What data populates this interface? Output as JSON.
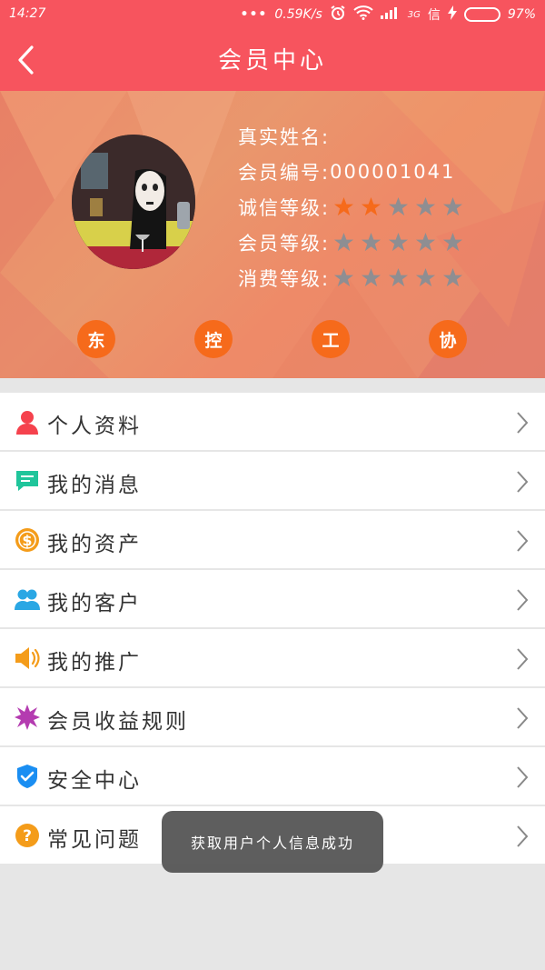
{
  "status_bar": {
    "time": "14:27",
    "dots": "•••",
    "speed": "0.59K/s",
    "network": "3G",
    "battery_pct": "97%",
    "battery_level": 0.97,
    "battery_color": "#56d653"
  },
  "header": {
    "title": "会员中心",
    "back_icon": "chevron-left-icon",
    "bg_color": "#f7545e"
  },
  "profile": {
    "name_label": "真实姓名:",
    "name_value": "",
    "member_no_label": "会员编号:",
    "member_no_value": "000001041",
    "credit_label": "诚信等级:",
    "credit_stars": 2,
    "member_level_label": "会员等级:",
    "member_level_stars": 0,
    "consume_label": "消费等级:",
    "consume_stars": 0,
    "max_stars": 5,
    "star_on_color": "#f66a1b",
    "star_off_color": "#8e8e92",
    "chips": [
      "东",
      "控",
      "工",
      "协"
    ],
    "chip_color": "#f66a1b"
  },
  "menu": [
    {
      "label": "个人资料",
      "icon": "person-icon",
      "color": "#f5424d"
    },
    {
      "label": "我的消息",
      "icon": "message-icon",
      "color": "#1fc59b"
    },
    {
      "label": "我的资产",
      "icon": "dollar-coin-icon",
      "color": "#f49c1a"
    },
    {
      "label": "我的客户",
      "icon": "users-icon",
      "color": "#2aa7e4"
    },
    {
      "label": "我的推广",
      "icon": "megaphone-icon",
      "color": "#f49c1a"
    },
    {
      "label": "会员收益规则",
      "icon": "starburst-icon",
      "color": "#b43bb0"
    },
    {
      "label": "安全中心",
      "icon": "shield-check-icon",
      "color": "#1a8ef2"
    },
    {
      "label": "常见问题",
      "icon": "question-icon",
      "color": "#f49c1a"
    }
  ],
  "toast": {
    "text": "获取用户个人信息成功"
  }
}
